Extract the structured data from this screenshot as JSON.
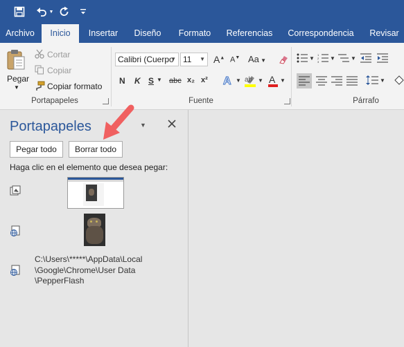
{
  "tabs": [
    {
      "label": "Archivo",
      "active": false
    },
    {
      "label": "Inicio",
      "active": true
    },
    {
      "label": "Insertar",
      "active": false
    },
    {
      "label": "Diseño",
      "active": false
    },
    {
      "label": "Formato",
      "active": false
    },
    {
      "label": "Referencias",
      "active": false
    },
    {
      "label": "Correspondencia",
      "active": false
    },
    {
      "label": "Revisar",
      "active": false
    }
  ],
  "clipboard_group": {
    "paste_label": "Pegar",
    "cut_label": "Cortar",
    "copy_label": "Copiar",
    "format_painter_label": "Copiar formato",
    "group_label": "Portapapeles"
  },
  "font_group": {
    "font_name": "Calibri (Cuerpo",
    "font_size": "11",
    "bold": "N",
    "italic": "K",
    "underline": "S",
    "strike": "abc",
    "subscript": "x₂",
    "superscript": "x²",
    "grow": "A",
    "shrink": "A",
    "case": "Aa",
    "group_label": "Fuente"
  },
  "paragraph_group": {
    "group_label": "Párrafo"
  },
  "pane": {
    "title": "Portapapeles",
    "paste_all": "Pegar todo",
    "clear_all": "Borrar todo",
    "instruction": "Haga clic en el elemento que desea pegar:",
    "path_lines": [
      "C:\\Users\\*****\\AppData\\Local",
      "\\Google\\Chrome\\User Data",
      "\\PepperFlash"
    ]
  },
  "colors": {
    "brand": "#2b579a",
    "arrow": "#f06060",
    "highlight": "#ffff00",
    "font_color": "#e02020"
  },
  "icons": [
    "save-icon",
    "undo-icon",
    "redo-icon",
    "customize-icon",
    "paste-icon",
    "scissors-icon",
    "copy-icon",
    "format-painter-icon",
    "clear-formatting-icon",
    "bullets-icon",
    "numbering-icon",
    "multilevel-icon",
    "decrease-indent-icon",
    "align-left-icon",
    "align-center-icon",
    "align-right-icon",
    "justify-icon",
    "line-spacing-icon",
    "shading-icon",
    "close-icon",
    "picture-clip-icon",
    "web-clip-icon"
  ]
}
